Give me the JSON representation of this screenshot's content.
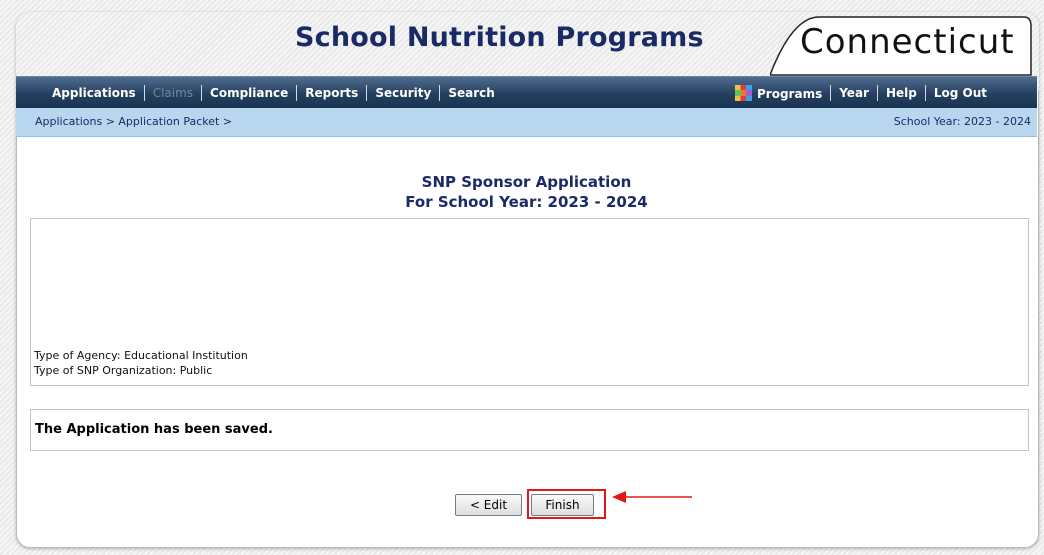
{
  "header": {
    "title": "School Nutrition Programs",
    "state": "Connecticut"
  },
  "nav": {
    "left": [
      "Applications",
      "Claims",
      "Compliance",
      "Reports",
      "Security",
      "Search"
    ],
    "disabled": [
      "Claims"
    ],
    "programs_icon": "programs-grid-icon",
    "right": [
      "Programs",
      "Year",
      "Help",
      "Log Out"
    ]
  },
  "breadcrumb": "Applications > Application Packet >",
  "school_year_label": "School Year: 2023 - 2024",
  "heading": {
    "line1": "SNP Sponsor Application",
    "line2": "For School Year: 2023 - 2024"
  },
  "info": {
    "agency_type": "Type of Agency: Educational Institution",
    "org_type": "Type of SNP Organization: Public"
  },
  "message": "The Application has been saved.",
  "buttons": {
    "edit": "< Edit",
    "finish": "Finish"
  },
  "colors": {
    "title": "#1a2a66",
    "nav_bg": "#25405f",
    "crumb_bg": "#b9d6ef",
    "highlight": "#e01818"
  }
}
